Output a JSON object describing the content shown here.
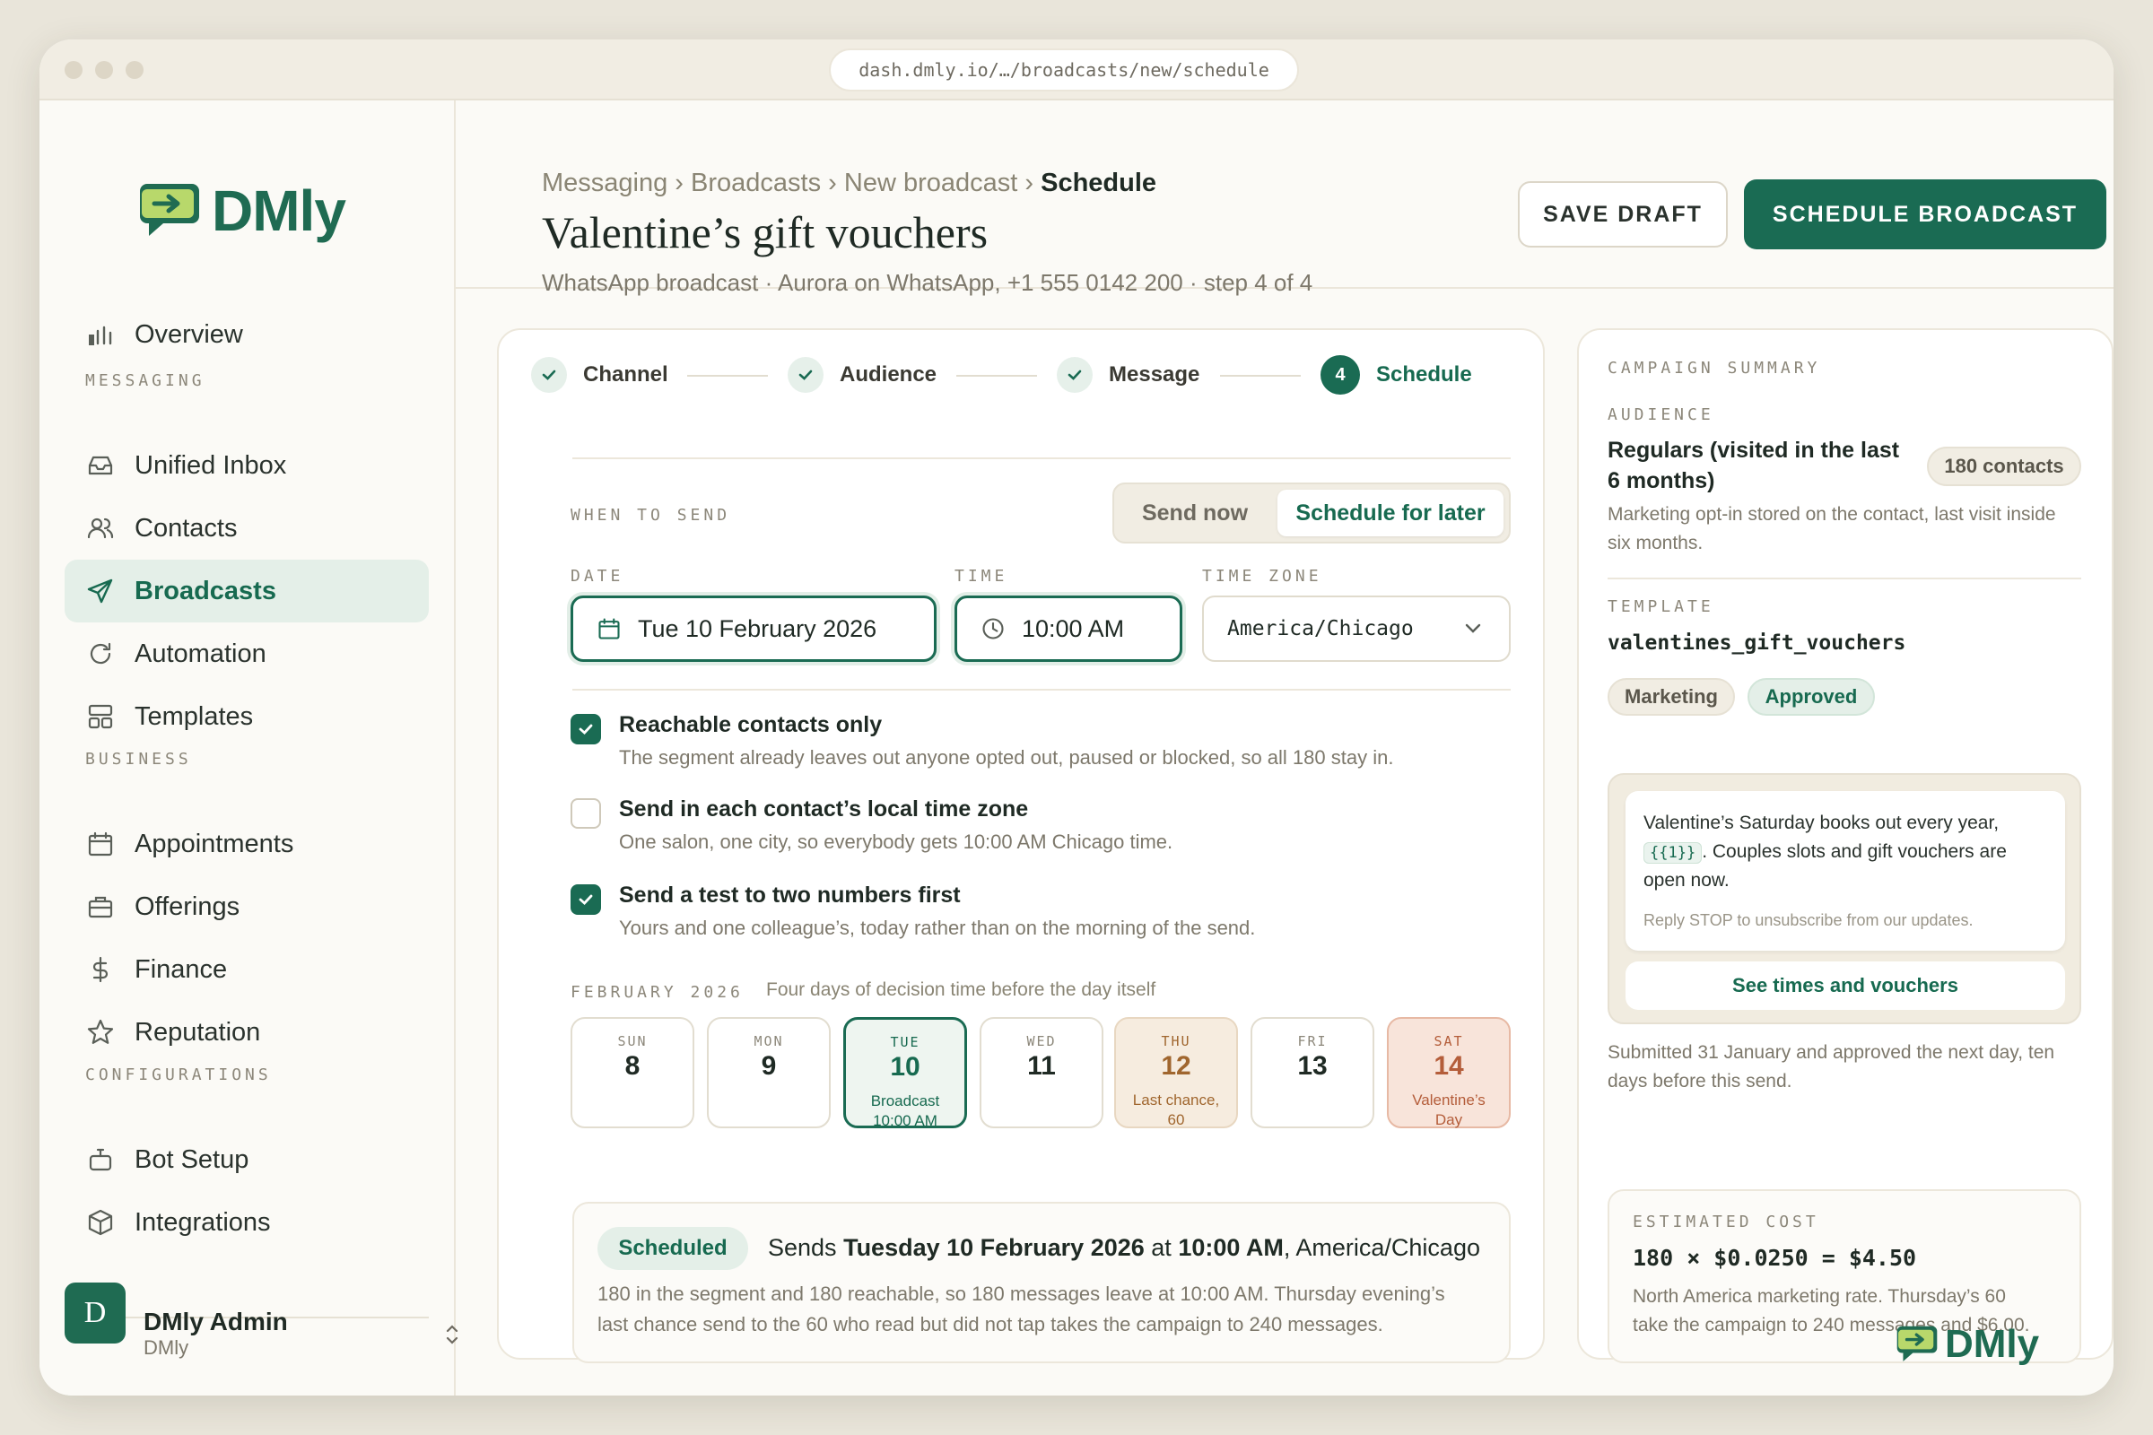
{
  "browser": {
    "url": "dash.dmly.io/…/broadcasts/new/schedule"
  },
  "brand": {
    "name": "DMly",
    "color": "#1f6b52",
    "accent": "#1a6b53"
  },
  "sidebar": {
    "overview": "Overview",
    "sections": [
      "MESSAGING",
      "BUSINESS",
      "CONFIGURATIONS"
    ],
    "messaging": [
      {
        "label": "Unified Inbox",
        "icon": "inbox-icon"
      },
      {
        "label": "Contacts",
        "icon": "contacts-icon"
      },
      {
        "label": "Broadcasts",
        "icon": "send-icon",
        "active": true
      },
      {
        "label": "Automation",
        "icon": "refresh-icon"
      },
      {
        "label": "Templates",
        "icon": "templates-icon"
      }
    ],
    "business": [
      {
        "label": "Appointments",
        "icon": "calendar-icon"
      },
      {
        "label": "Offerings",
        "icon": "briefcase-icon"
      },
      {
        "label": "Finance",
        "icon": "dollar-icon"
      },
      {
        "label": "Reputation",
        "icon": "star-icon"
      }
    ],
    "configurations": [
      {
        "label": "Bot Setup",
        "icon": "bot-icon"
      },
      {
        "label": "Integrations",
        "icon": "cube-icon"
      }
    ],
    "user": {
      "initial": "D",
      "name": "DMly Admin",
      "org": "DMly"
    }
  },
  "header": {
    "breadcrumbs": [
      "Messaging",
      "Broadcasts",
      "New broadcast",
      "Schedule"
    ],
    "title": "Valentine’s gift vouchers",
    "subtitle": "WhatsApp broadcast · Aurora on WhatsApp, +1 555 0142 200 · step 4 of 4",
    "save_draft": "SAVE DRAFT",
    "schedule_broadcast": "SCHEDULE BROADCAST"
  },
  "steps": [
    {
      "label": "Channel",
      "done": true
    },
    {
      "label": "Audience",
      "done": true
    },
    {
      "label": "Message",
      "done": true
    },
    {
      "label": "Schedule",
      "number": "4",
      "current": true
    }
  ],
  "when": {
    "label": "WHEN TO SEND",
    "options": [
      "Send now",
      "Schedule for later"
    ],
    "selected": "Schedule for later"
  },
  "fields": {
    "date_label": "DATE",
    "date_value": "Tue 10 February 2026",
    "time_label": "TIME",
    "time_value": "10:00 AM",
    "tz_label": "TIME ZONE",
    "tz_value": "America/Chicago"
  },
  "options": [
    {
      "title": "Reachable contacts only",
      "desc": "The segment already leaves out anyone opted out, paused or blocked, so all 180 stay in.",
      "checked": true
    },
    {
      "title": "Send in each contact’s local time zone",
      "desc": "One salon, one city, so everybody gets 10:00 AM Chicago time.",
      "checked": false
    },
    {
      "title": "Send a test to two numbers first",
      "desc": "Yours and one colleague’s, today rather than on the morning of the send.",
      "checked": true
    }
  ],
  "calendar": {
    "month": "FEBRUARY 2026",
    "caption": "Four days of decision time before the day itself",
    "days": [
      {
        "dow": "SUN",
        "num": "8",
        "note": ""
      },
      {
        "dow": "MON",
        "num": "9",
        "note": ""
      },
      {
        "dow": "TUE",
        "num": "10",
        "note": "Broadcast\n10:00 AM",
        "state": "selected"
      },
      {
        "dow": "WED",
        "num": "11",
        "note": ""
      },
      {
        "dow": "THU",
        "num": "12",
        "note": "Last chance,\n60",
        "state": "warn"
      },
      {
        "dow": "FRI",
        "num": "13",
        "note": ""
      },
      {
        "dow": "SAT",
        "num": "14",
        "note": "Valentine’s\nDay",
        "state": "red"
      }
    ]
  },
  "scheduled": {
    "badge": "Scheduled",
    "sends": "Sends",
    "date": "Tuesday 10 February 2026",
    "at": "at",
    "time": "10:00 AM",
    "tz": ", America/Chicago",
    "desc1": "180 in the segment and 180 reachable, so 180 messages leave at 10:00 AM. Thursday evening’s",
    "desc2": "last chance send to the 60 who read but did not tap takes the campaign to 240 messages."
  },
  "summary": {
    "title": "CAMPAIGN SUMMARY",
    "audience_label": "AUDIENCE",
    "audience_line1": "Regulars (visited in the last",
    "audience_line2": "6 months)",
    "contacts_badge": "180 contacts",
    "audience_desc1": "Marketing opt-in stored on the contact, last visit inside",
    "audience_desc2": "six months.",
    "template_label": "TEMPLATE",
    "template_name": "valentines_gift_vouchers",
    "tags": [
      "Marketing",
      "Approved"
    ],
    "preview_line1": "Valentine’s Saturday books out every year,",
    "preview_var": "{{1}}",
    "preview_line2b": ". Couples slots and gift vouchers are",
    "preview_line3": "open now.",
    "preview_footer": "Reply STOP to unsubscribe from our updates.",
    "preview_button": "See times and vouchers",
    "submitted1": "Submitted 31 January and approved the next day, ten",
    "submitted2": "days before this send.",
    "cost_label": "ESTIMATED COST",
    "cost_formula": "180 × $0.0250 = $4.50",
    "cost_desc1": "North America marketing rate. Thursday’s 60",
    "cost_desc2": "take the campaign to 240 messages and $6.00."
  }
}
